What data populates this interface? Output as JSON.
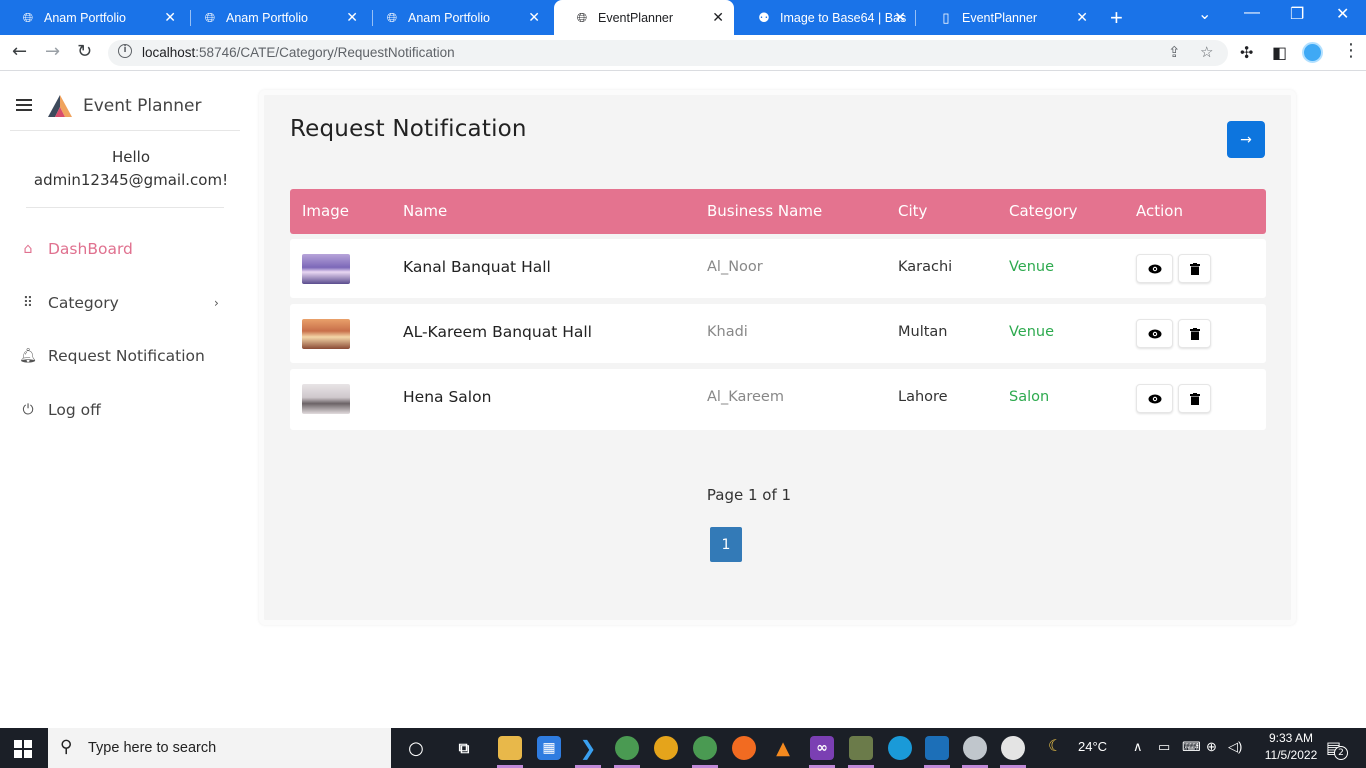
{
  "browser": {
    "tabs": [
      {
        "title": "Anam Portfolio",
        "icon": "globe-icon",
        "active": false
      },
      {
        "title": "Anam Portfolio",
        "icon": "globe-icon",
        "active": false
      },
      {
        "title": "Anam Portfolio",
        "icon": "globe-icon",
        "active": false
      },
      {
        "title": "EventPlanner",
        "icon": "globe-icon",
        "active": true
      },
      {
        "title": "Image to Base64 | Bas",
        "icon": "base64-site-icon",
        "active": false
      },
      {
        "title": "EventPlanner",
        "icon": "document-icon",
        "active": false
      }
    ],
    "url_host": "localhost",
    "url_path": ":58746/CATE/Category/RequestNotification"
  },
  "sidebar": {
    "brand": "Event Planner",
    "greeting_line1": "Hello",
    "greeting_line2": "admin12345@gmail.com!",
    "items": [
      {
        "label": "DashBoard",
        "icon": "home-icon",
        "active": true
      },
      {
        "label": "Category",
        "icon": "grid-dots-icon",
        "active": false,
        "has_chevron": true,
        "chevron": "›"
      },
      {
        "label": "Request Notification",
        "icon": "bell-icon",
        "active": false
      },
      {
        "label": "Log off",
        "icon": "power-icon",
        "active": false
      }
    ]
  },
  "main": {
    "title": "Request Notification",
    "go_button_icon": "→",
    "table": {
      "columns": [
        "Image",
        "Name",
        "Business Name",
        "City",
        "Category",
        "Action"
      ],
      "rows": [
        {
          "name": "Kanal Banquat Hall",
          "business": "Al_Noor",
          "city": "Karachi",
          "category": "Venue"
        },
        {
          "name": "AL-Kareem Banquat Hall",
          "business": "Khadi",
          "city": "Multan",
          "category": "Venue"
        },
        {
          "name": "Hena Salon",
          "business": "Al_Kareem",
          "city": "Lahore",
          "category": "Salon"
        }
      ]
    },
    "pagination": {
      "info": "Page 1 of 1",
      "current": "1"
    }
  },
  "taskbar": {
    "search_placeholder": "Type here to search",
    "weather": "24°C",
    "time": "9:33 AM",
    "date": "11/5/2022",
    "notification_count": "2"
  },
  "colors": {
    "accent_pink": "#e4738f",
    "primary_blue": "#0d75de",
    "category_green": "#2eaa4f",
    "chrome_blue": "#1a73e8"
  }
}
